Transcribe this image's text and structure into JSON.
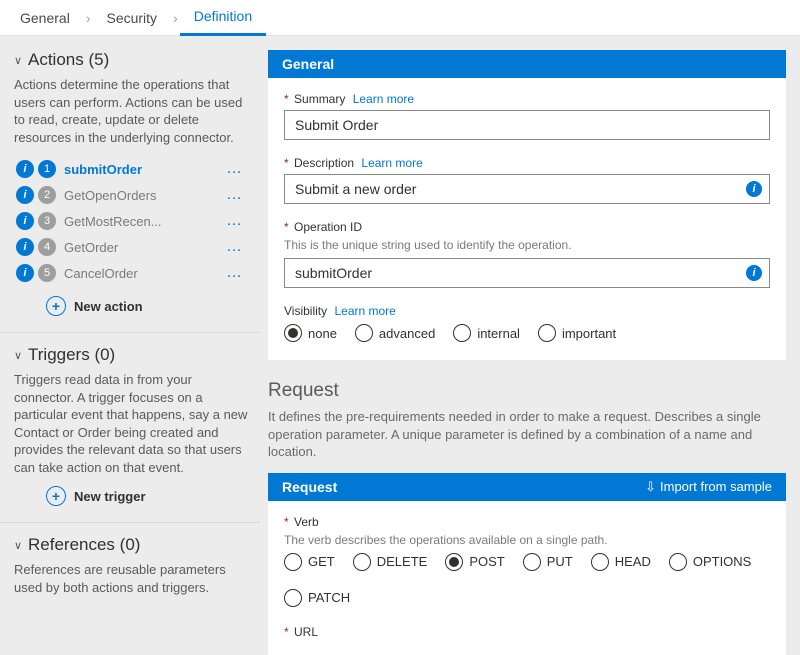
{
  "tabs": {
    "items": [
      "General",
      "Security",
      "Definition"
    ],
    "active_index": 2
  },
  "sidebar": {
    "actions": {
      "title": "Actions (5)",
      "desc": "Actions determine the operations that users can perform. Actions can be used to read, create, update or delete resources in the underlying connector.",
      "items": [
        {
          "num": "1",
          "label": "submitOrder",
          "selected": true
        },
        {
          "num": "2",
          "label": "GetOpenOrders",
          "selected": false
        },
        {
          "num": "3",
          "label": "GetMostRecen...",
          "selected": false
        },
        {
          "num": "4",
          "label": "GetOrder",
          "selected": false
        },
        {
          "num": "5",
          "label": "CancelOrder",
          "selected": false
        }
      ],
      "add": "New action"
    },
    "triggers": {
      "title": "Triggers (0)",
      "desc": "Triggers read data in from your connector. A trigger focuses on a particular event that happens, say a new Contact or Order being created and provides the relevant data so that users can take action on that event.",
      "add": "New trigger"
    },
    "references": {
      "title": "References (0)",
      "desc": "References are reusable parameters used by both actions and triggers."
    }
  },
  "general": {
    "panel_title": "General",
    "summary_label": "Summary",
    "summary_value": "Submit Order",
    "description_label": "Description",
    "description_value": "Submit a new order",
    "operation_id_label": "Operation ID",
    "operation_id_desc": "This is the unique string used to identify the operation.",
    "operation_id_value": "submitOrder",
    "visibility_label": "Visibility",
    "visibility_options": [
      "none",
      "advanced",
      "internal",
      "important"
    ],
    "visibility_selected": "none",
    "learn_more": "Learn more"
  },
  "request": {
    "heading": "Request",
    "intro": "It defines the pre-requirements needed in order to make a request. Describes a single operation parameter. A unique parameter is defined by a combination of a name and location.",
    "panel_title": "Request",
    "import_label": "Import from sample",
    "verb_label": "Verb",
    "verb_desc": "The verb describes the operations available on a single path.",
    "verb_options": [
      "GET",
      "DELETE",
      "POST",
      "PUT",
      "HEAD",
      "OPTIONS",
      "PATCH"
    ],
    "verb_selected": "POST",
    "url_label": "URL"
  }
}
